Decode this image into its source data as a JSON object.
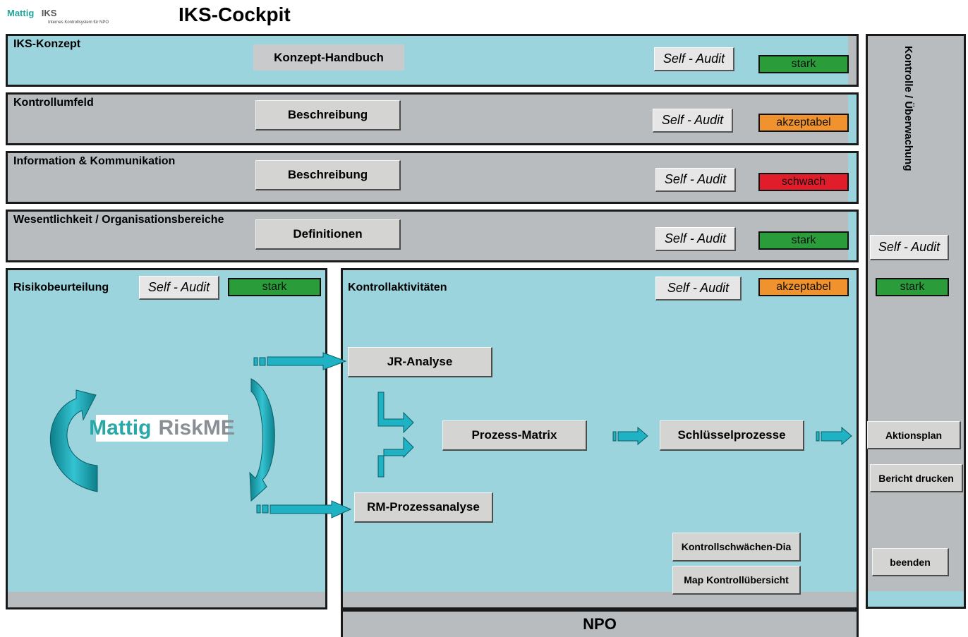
{
  "header": {
    "logo_brand": "Mattig",
    "logo_product": "IKS",
    "logo_subtitle": "Internes Kontrollsystem für NPO",
    "title": "IKS-Cockpit"
  },
  "rows": [
    {
      "title": "IKS-Konzept",
      "button": "Konzept-Handbuch",
      "audit": "Self - Audit",
      "status": "stark"
    },
    {
      "title": "Kontrollumfeld",
      "button": "Beschreibung",
      "audit": "Self - Audit",
      "status": "akzeptabel"
    },
    {
      "title": "Information & Kommunikation",
      "button": "Beschreibung",
      "audit": "Self - Audit",
      "status": "schwach"
    },
    {
      "title": "Wesentlichkeit / Organisationsbereiche",
      "button": "Definitionen",
      "audit": "Self - Audit",
      "status": "stark"
    }
  ],
  "risk": {
    "title": "Risikobeurteilung",
    "audit": "Self - Audit",
    "status": "stark",
    "logo_left": "Mattig",
    "logo_right": "RiskME"
  },
  "control": {
    "title": "Kontrollaktivitäten",
    "audit": "Self - Audit",
    "status": "akzeptabel",
    "jr": "JR-Analyse",
    "rm": "RM-Prozessanalyse",
    "matrix": "Prozess-Matrix",
    "key": "Schlüsselprozesse",
    "weak": "Kontrollschwächen-Dia",
    "map": "Map Kontrollübersicht"
  },
  "side": {
    "title": "Kontrolle / Überwachung",
    "audit": "Self - Audit",
    "status": "stark",
    "aktionsplan": "Aktionsplan",
    "bericht": "Bericht drucken",
    "beenden": "beenden"
  },
  "footer": {
    "npo": "NPO"
  },
  "colors": {
    "stark": "#2b9c3a",
    "akzeptabel": "#f0922d",
    "schwach": "#e11d2b",
    "panel_teal": "#9bd4dc",
    "panel_grey": "#b8bcbe",
    "arrow": "#1fb1c4"
  }
}
